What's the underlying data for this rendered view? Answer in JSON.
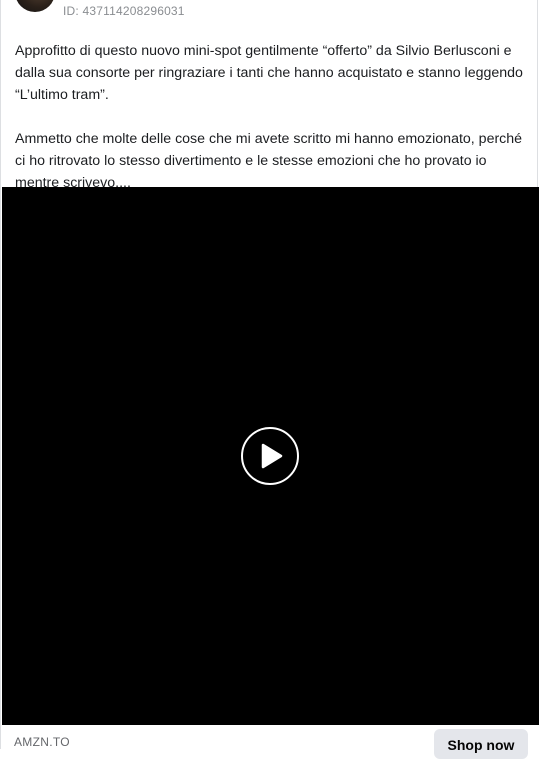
{
  "ad": {
    "id_text": "ID: 437114208296031"
  },
  "post": {
    "paragraphs": [
      "Approfitto di questo nuovo mini-spot gentilmente “offerto” da Silvio Berlusconi e dalla sua consorte per ringraziare i tanti che hanno acquistato e stanno leggendo “L’ultimo tram”.",
      "Ammetto che molte delle cose che mi avete scritto mi hanno emozionato, perché ci ho ritrovato lo stesso divertimento e le stesse emozioni che ho provato io mentre scrivevo...."
    ]
  },
  "video": {
    "play_icon": "play-icon",
    "background": "#000000"
  },
  "link": {
    "domain": "AMZN.TO",
    "cta_label": "Shop now"
  }
}
